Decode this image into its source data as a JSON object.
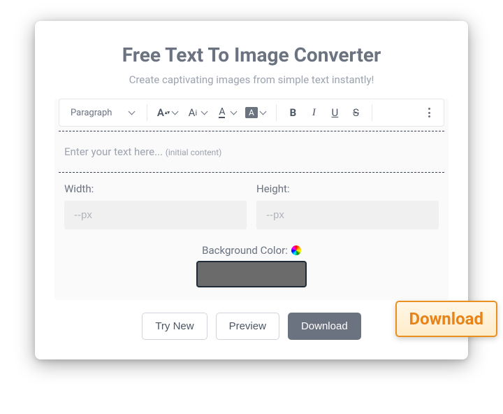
{
  "header": {
    "title": "Free Text To Image Converter",
    "subtitle": "Create captivating images from simple text instantly!"
  },
  "toolbar": {
    "paragraph_label": "Paragraph",
    "font_size_letter": "A",
    "letter_case_big": "A",
    "letter_case_small": "I",
    "font_color_letter": "A",
    "bg_color_letter": "A",
    "bold_letter": "B",
    "italic_letter": "I",
    "underline_letter": "U",
    "strike_letter": "S"
  },
  "editor": {
    "placeholder_main": "Enter your text here... ",
    "placeholder_hint": "(initial content)"
  },
  "dimensions": {
    "width_label": "Width:",
    "height_label": "Height:",
    "placeholder": "--px"
  },
  "bgcolor": {
    "label": "Background Color:",
    "value": "#6b6b6b"
  },
  "buttons": {
    "try_new": "Try New",
    "preview": "Preview",
    "download": "Download"
  },
  "callout": {
    "text": "Download"
  }
}
